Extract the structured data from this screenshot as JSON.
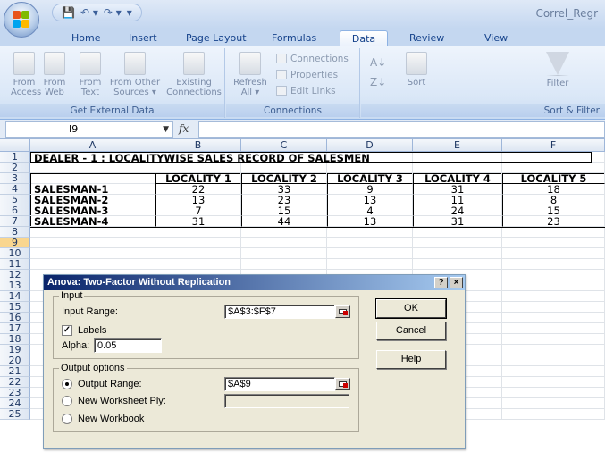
{
  "window": {
    "title": "Correl_Regr",
    "quick_access": [
      "💾",
      "↶ ▾",
      "↷ ▾",
      "▾"
    ]
  },
  "tabs": [
    "Home",
    "Insert",
    "Page Layout",
    "Formulas",
    "Data",
    "Review",
    "View"
  ],
  "active_tab": "Data",
  "ribbon": {
    "get_external_data": {
      "label": "Get External Data",
      "buttons": [
        "From\nAccess",
        "From\nWeb",
        "From\nText",
        "From Other\nSources ▾",
        "Existing\nConnections"
      ]
    },
    "connections": {
      "label": "Connections",
      "refresh": "Refresh\nAll ▾",
      "items": [
        "Connections",
        "Properties",
        "Edit Links"
      ]
    },
    "sort_filter": {
      "label": "Sort & Filter",
      "sort": "Sort",
      "filter": "Filter"
    }
  },
  "formula_bar": {
    "name_box": "I9",
    "fx": "fx",
    "value": ""
  },
  "sheet": {
    "columns": [
      "A",
      "B",
      "C",
      "D",
      "E",
      "F"
    ],
    "rows": [
      "1",
      "2",
      "3",
      "4",
      "5",
      "6",
      "7",
      "8",
      "9",
      "10",
      "11",
      "12",
      "13",
      "14",
      "15",
      "16",
      "17",
      "18",
      "19",
      "20",
      "21",
      "22",
      "23",
      "24",
      "25"
    ],
    "title": "DEALER - 1 : LOCALITYWISE SALES RECORD OF SALESMEN",
    "headers": [
      "LOCALITY 1",
      "LOCALITY 2",
      "LOCALITY 3",
      "LOCALITY 4",
      "LOCALITY 5"
    ],
    "data": [
      {
        "name": "SALESMAN-1",
        "values": [
          "22",
          "33",
          "9",
          "31",
          "18"
        ]
      },
      {
        "name": "SALESMAN-2",
        "values": [
          "13",
          "23",
          "13",
          "11",
          "8"
        ]
      },
      {
        "name": "SALESMAN-3",
        "values": [
          "7",
          "15",
          "4",
          "24",
          "15"
        ]
      },
      {
        "name": "SALESMAN-4",
        "values": [
          "31",
          "44",
          "13",
          "31",
          "23"
        ]
      }
    ]
  },
  "dialog": {
    "title": "Anova: Two-Factor Without Replication",
    "help_btn": "?",
    "close_btn": "×",
    "input_group": "Input",
    "input_range_label": "Input Range:",
    "input_range_value": "$A$3:$F$7",
    "labels_label": "Labels",
    "labels_checked": true,
    "alpha_label": "Alpha:",
    "alpha_value": "0.05",
    "output_group": "Output options",
    "output_range_label": "Output Range:",
    "output_range_value": "$A$9",
    "new_ply_label": "New Worksheet Ply:",
    "new_workbook_label": "New Workbook",
    "ok": "OK",
    "cancel": "Cancel",
    "help": "Help"
  }
}
